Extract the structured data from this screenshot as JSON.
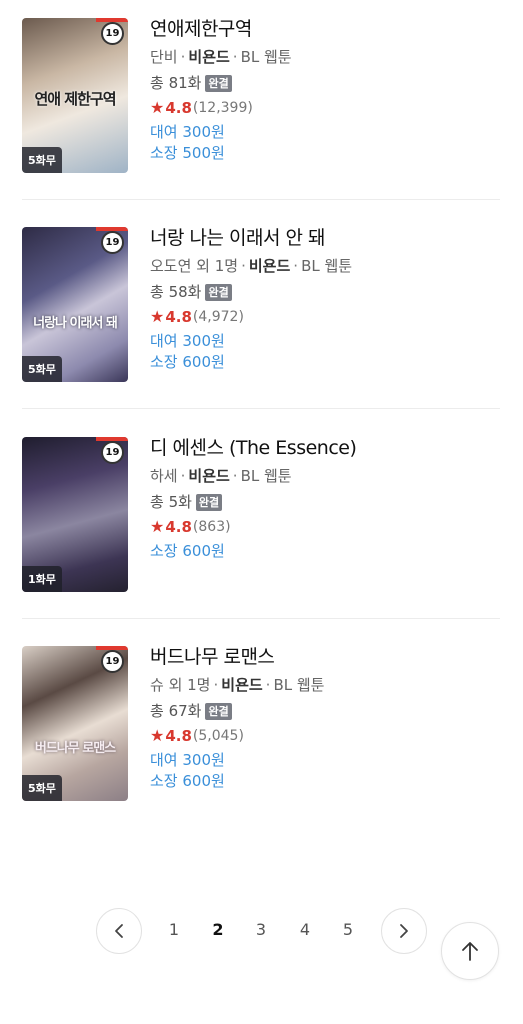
{
  "items": [
    {
      "title": "연애제한구역",
      "author": "단비",
      "publisher": "비욘드",
      "genre": "BL 웹툰",
      "episodes": "총 81화",
      "status": "완결",
      "rating": "4.8",
      "votes": "(12,399)",
      "rent": "대여 300원",
      "own": "소장 500원",
      "age": "19",
      "free_badge": "5화무",
      "cover_text": "연애 제한구역"
    },
    {
      "title": "너랑 나는 이래서 안 돼",
      "author": "오도연 외 1명",
      "publisher": "비욘드",
      "genre": "BL 웹툰",
      "episodes": "총 58화",
      "status": "완결",
      "rating": "4.8",
      "votes": "(4,972)",
      "rent": "대여 300원",
      "own": "소장 600원",
      "age": "19",
      "free_badge": "5화무",
      "cover_text": "너랑나 이래서 돼"
    },
    {
      "title": "디 에센스 (The Essence)",
      "author": "하세",
      "publisher": "비욘드",
      "genre": "BL 웹툰",
      "episodes": "총 5화",
      "status": "완결",
      "rating": "4.8",
      "votes": "(863)",
      "own": "소장 600원",
      "age": "19",
      "free_badge": "1화무",
      "cover_text": ""
    },
    {
      "title": "버드나무 로맨스",
      "author": "슈 외 1명",
      "publisher": "비욘드",
      "genre": "BL 웹툰",
      "episodes": "총 67화",
      "status": "완결",
      "rating": "4.8",
      "votes": "(5,045)",
      "rent": "대여 300원",
      "own": "소장 600원",
      "age": "19",
      "free_badge": "5화무",
      "cover_text": "버드나무 로맨스"
    }
  ],
  "separator": "·",
  "pagination": {
    "pages": [
      "1",
      "2",
      "3",
      "4",
      "5"
    ],
    "current": "2",
    "prev_icon": "chevron-left-icon",
    "next_icon": "chevron-right-icon"
  },
  "scroll_top_icon": "arrow-up-icon",
  "colors": {
    "rating": "#d8382e",
    "price": "#3a8fd9",
    "badge": "#7a7d85"
  }
}
